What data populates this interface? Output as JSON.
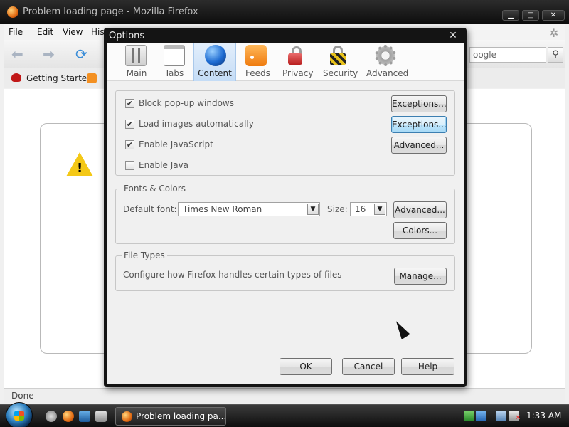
{
  "firefox": {
    "title": "Problem loading page - Mozilla Firefox",
    "menu": [
      "File",
      "Edit",
      "View",
      "His"
    ],
    "search_placeholder": "oogle",
    "bookmark_label": "Getting Started",
    "status": "Done"
  },
  "options": {
    "title": "Options",
    "panes": [
      {
        "label": "Main",
        "icon": "main-icon"
      },
      {
        "label": "Tabs",
        "icon": "tabs-icon"
      },
      {
        "label": "Content",
        "icon": "content-globe-icon",
        "selected": true
      },
      {
        "label": "Feeds",
        "icon": "feeds-icon"
      },
      {
        "label": "Privacy",
        "icon": "privacy-lock-icon"
      },
      {
        "label": "Security",
        "icon": "security-lock-icon"
      },
      {
        "label": "Advanced",
        "icon": "advanced-gear-icon"
      }
    ],
    "general": {
      "block_popups": {
        "label": "Block pop-up windows",
        "checked": true
      },
      "load_images": {
        "label": "Load images automatically",
        "checked": true
      },
      "enable_js": {
        "label": "Enable JavaScript",
        "checked": true
      },
      "enable_java": {
        "label": "Enable Java",
        "checked": false
      },
      "exceptions_label": "Exceptions...",
      "advanced_label": "Advanced..."
    },
    "fonts": {
      "legend": "Fonts & Colors",
      "default_font_label": "Default font:",
      "default_font_value": "Times New Roman",
      "size_label": "Size:",
      "size_value": "16",
      "advanced_label": "Advanced...",
      "colors_label": "Colors..."
    },
    "file_types": {
      "legend": "File Types",
      "description": "Configure how Firefox handles certain types of files",
      "manage_label": "Manage..."
    },
    "buttons": {
      "ok": "OK",
      "cancel": "Cancel",
      "help": "Help"
    }
  },
  "taskbar": {
    "task_label": "Problem loading pa...",
    "clock": "1:33 AM"
  }
}
